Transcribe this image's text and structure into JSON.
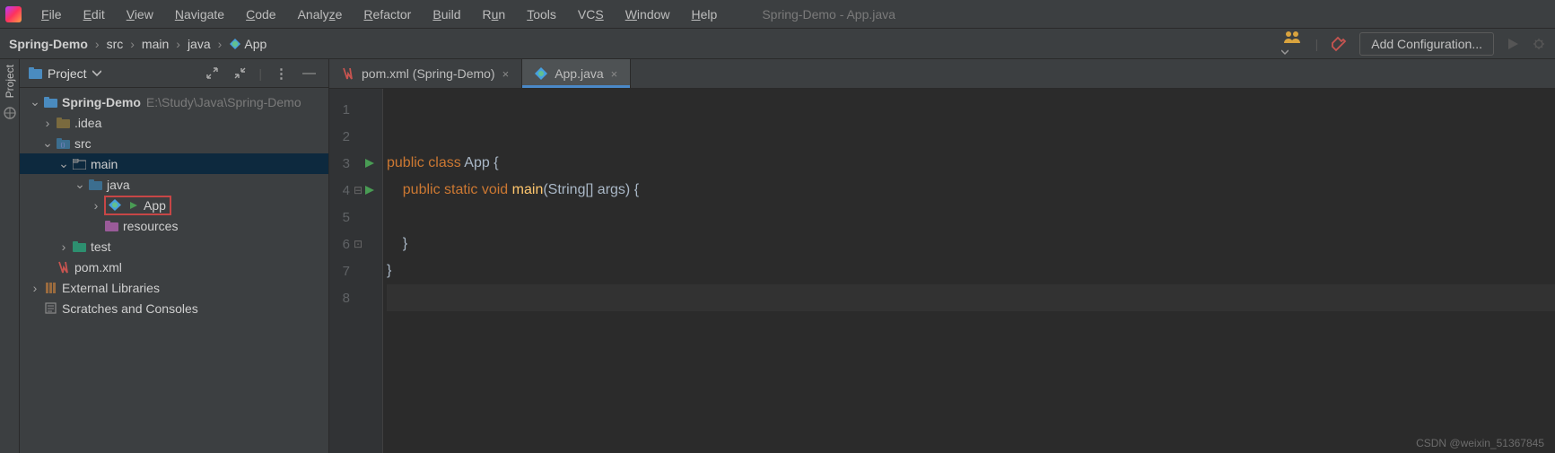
{
  "menubar": {
    "items": [
      "File",
      "Edit",
      "View",
      "Navigate",
      "Code",
      "Analyze",
      "Refactor",
      "Build",
      "Run",
      "Tools",
      "VCS",
      "Window",
      "Help"
    ],
    "title": "Spring-Demo - App.java"
  },
  "breadcrumb": {
    "items": [
      "Spring-Demo",
      "src",
      "main",
      "java",
      "App"
    ]
  },
  "toolbar": {
    "add_config": "Add Configuration..."
  },
  "sidebar": {
    "project_label": "Project"
  },
  "projectPanel": {
    "title": "Project"
  },
  "tree": {
    "root": {
      "label": "Spring-Demo",
      "path": "E:\\Study\\Java\\Spring-Demo"
    },
    "idea": ".idea",
    "src": "src",
    "main": "main",
    "java": "java",
    "app": "App",
    "resources": "resources",
    "test": "test",
    "pom": "pom.xml",
    "extlib": "External Libraries",
    "scratches": "Scratches and Consoles"
  },
  "tabs": [
    {
      "label": "pom.xml (Spring-Demo)",
      "active": false,
      "type": "maven"
    },
    {
      "label": "App.java",
      "active": true,
      "type": "class"
    }
  ],
  "code": {
    "lines": [
      "",
      "",
      "public class App {",
      "    public static void main(String[] args) {",
      "",
      "    }",
      "}",
      ""
    ],
    "lineCount": 8,
    "runMarkers": [
      3,
      4
    ],
    "currentLine": 8
  },
  "watermark": "CSDN @weixin_51367845"
}
